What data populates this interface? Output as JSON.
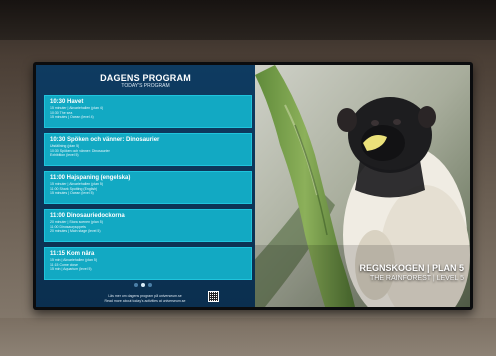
{
  "program": {
    "title": "DAGENS PROGRAM",
    "subtitle": "TODAY'S PROGRAM"
  },
  "schedule": [
    {
      "title": "10:30 Havet",
      "line1": "15 minuter | Akvariehallen (plan 4)",
      "line2": "10:30 The sea",
      "line3": "15 minutes | Ocean (level 4)"
    },
    {
      "title": "10:30 Spöken och vänner: Dinosaurier",
      "line1": "Utställning (plan 5)",
      "line2": "10:30 Spöken och vänner: Dinosaurier",
      "line3": "Exhibition (level 5)"
    },
    {
      "title": "11:00 Hajspaning (engelska)",
      "line1": "15 minuter | Akvariehallen (plan 5)",
      "line2": "11:00 Shark Spotting (English)",
      "line3": "15 minutes | Ocean (level 5)"
    },
    {
      "title": "11:00 Dinosauriedockorna",
      "line1": "20 minuter | Stora scenen (plan 5)",
      "line2": "11:00 Dinosaurpuppets",
      "line3": "20 minutes | Main stage (level 5)"
    },
    {
      "title": "11:15 Kom nära",
      "line1": "15 min | Akvariehallen (plan 5)",
      "line2": "11:15 Come close",
      "line3": "15 min | Aquarium (level 5)"
    }
  ],
  "footer": {
    "line1": "Läs mer om dagens program på universeum.se",
    "line2": "Read more about today's activities at universeum.se"
  },
  "pagination": {
    "count": 3,
    "active_index": 1
  },
  "caption": {
    "main": "REGNSKOGEN | PLAN 5",
    "sub": "THE RAINFOREST | LEVEL 5"
  },
  "colors": {
    "panel": "#0e3b61",
    "card": "#12a9c3"
  },
  "icons": [
    "qr-code-icon"
  ]
}
